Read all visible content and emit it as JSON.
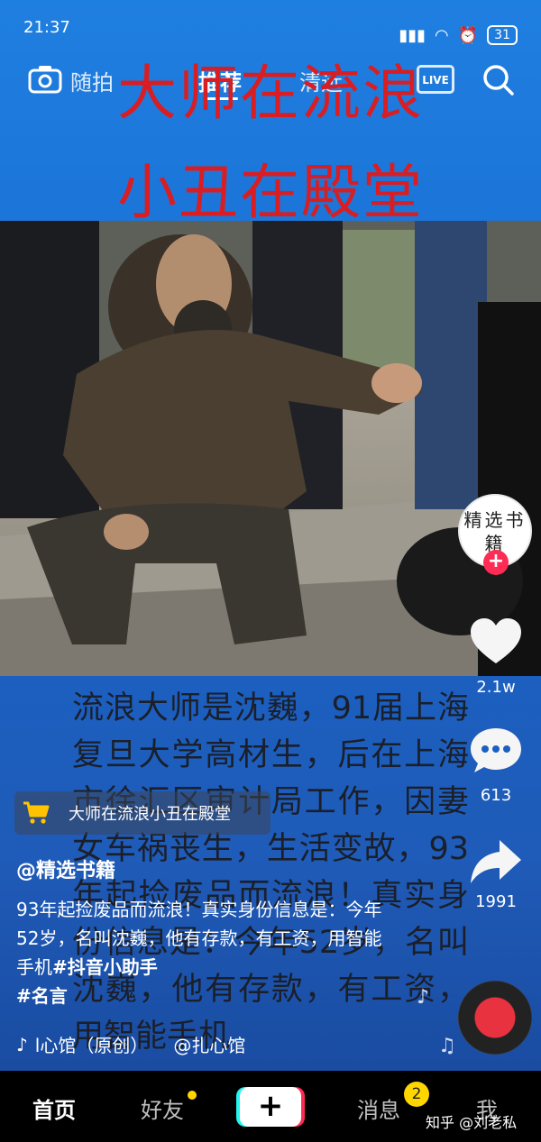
{
  "status": {
    "time": "21:37",
    "battery": "31"
  },
  "nav": {
    "camera_label": "随拍",
    "recommend": "推荐",
    "location": "清远",
    "live": "LIVE"
  },
  "overlay": {
    "line1": "大师在流浪",
    "line2": "小丑在殿堂"
  },
  "bigtext": "流浪大师是沈巍，91届上海复旦大学高材生，后在上海市徐汇区审计局工作，因妻女车祸丧生，生活变故，93年起捡废品而流浪！真实身份信息是：今年52岁，名叫沈巍，他有存款，有工资，用智能手机",
  "sidebar": {
    "avatar_text": "精选书籍",
    "follow": "+",
    "likes": "2.1w",
    "comments": "613",
    "shares": "1991"
  },
  "mini_link": "大师在流浪小丑在殿堂",
  "author": "@精选书籍",
  "desc": {
    "text": "93年起捡废品而流浪！真实身份信息是：今年52岁，名叫沈巍，他有存款，有工资，用智能手机",
    "tag1": "#抖音小助手",
    "tag2": "#名言"
  },
  "music": {
    "name": "l心馆（原创）",
    "at": "@扎心馆"
  },
  "tabs": {
    "home": "首页",
    "friends": "好友",
    "plus": "+",
    "messages": "消息",
    "me": "我",
    "badge": "2"
  },
  "watermark": "知乎 @刘老私",
  "colors": {
    "overlay_red": "#d81e22",
    "accent": "#fe2c55",
    "badge": "#ffd600"
  }
}
